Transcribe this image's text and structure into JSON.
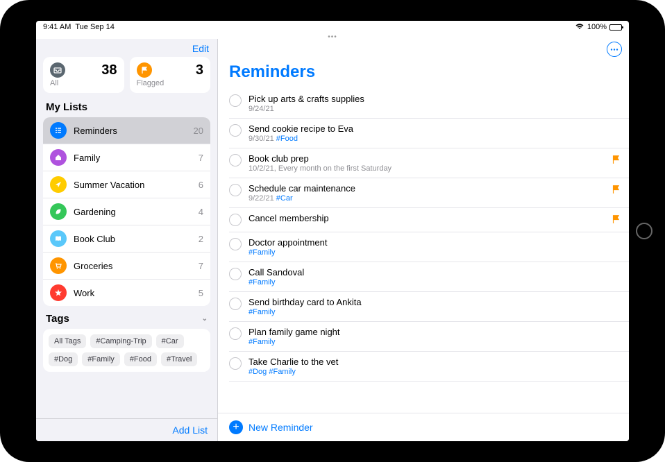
{
  "status_bar": {
    "time": "9:41 AM",
    "date": "Tue Sep 14",
    "battery_pct": "100%",
    "wifi_icon": "wifi",
    "battery_icon": "battery-full"
  },
  "sidebar": {
    "edit_label": "Edit",
    "smart_lists": [
      {
        "id": "all",
        "label": "All",
        "count": "38",
        "icon_bg": "#5b6770",
        "icon_svg": "inbox"
      },
      {
        "id": "flagged",
        "label": "Flagged",
        "count": "3",
        "icon_bg": "#ff9500",
        "icon_svg": "flag"
      }
    ],
    "my_lists_label": "My Lists",
    "lists": [
      {
        "name": "Reminders",
        "count": "20",
        "icon_bg": "#007aff",
        "icon": "list",
        "selected": true
      },
      {
        "name": "Family",
        "count": "7",
        "icon_bg": "#af52de",
        "icon": "home"
      },
      {
        "name": "Summer Vacation",
        "count": "6",
        "icon_bg": "#ffcc00",
        "icon": "plane"
      },
      {
        "name": "Gardening",
        "count": "4",
        "icon_bg": "#34c759",
        "icon": "leaf"
      },
      {
        "name": "Book Club",
        "count": "2",
        "icon_bg": "#5ac8fa",
        "icon": "book"
      },
      {
        "name": "Groceries",
        "count": "7",
        "icon_bg": "#ff9500",
        "icon": "cart"
      },
      {
        "name": "Work",
        "count": "5",
        "icon_bg": "#ff3b30",
        "icon": "star"
      }
    ],
    "tags_label": "Tags",
    "tags": [
      "All Tags",
      "#Camping-Trip",
      "#Car",
      "#Dog",
      "#Family",
      "#Food",
      "#Travel"
    ],
    "add_list_label": "Add List"
  },
  "main": {
    "title": "Reminders",
    "more_label": "...",
    "reminders": [
      {
        "title": "Pick up arts & crafts supplies",
        "sub": "9/24/21",
        "tags": "",
        "flagged": false
      },
      {
        "title": "Send cookie recipe to Eva",
        "sub": "9/30/21 ",
        "tags": "#Food",
        "flagged": false
      },
      {
        "title": "Book club prep",
        "sub": "10/2/21, Every month on the first Saturday",
        "tags": "",
        "flagged": true
      },
      {
        "title": "Schedule car maintenance",
        "sub": "9/22/21 ",
        "tags": "#Car",
        "flagged": true
      },
      {
        "title": "Cancel membership",
        "sub": "",
        "tags": "",
        "flagged": true
      },
      {
        "title": "Doctor appointment",
        "sub": "",
        "tags": "#Family",
        "flagged": false
      },
      {
        "title": "Call Sandoval",
        "sub": "",
        "tags": "#Family",
        "flagged": false
      },
      {
        "title": "Send birthday card to Ankita",
        "sub": "",
        "tags": "#Family",
        "flagged": false
      },
      {
        "title": "Plan family game night",
        "sub": "",
        "tags": "#Family",
        "flagged": false
      },
      {
        "title": "Take Charlie to the vet",
        "sub": "",
        "tags": "#Dog #Family",
        "flagged": false
      }
    ],
    "new_reminder_label": "New Reminder"
  }
}
